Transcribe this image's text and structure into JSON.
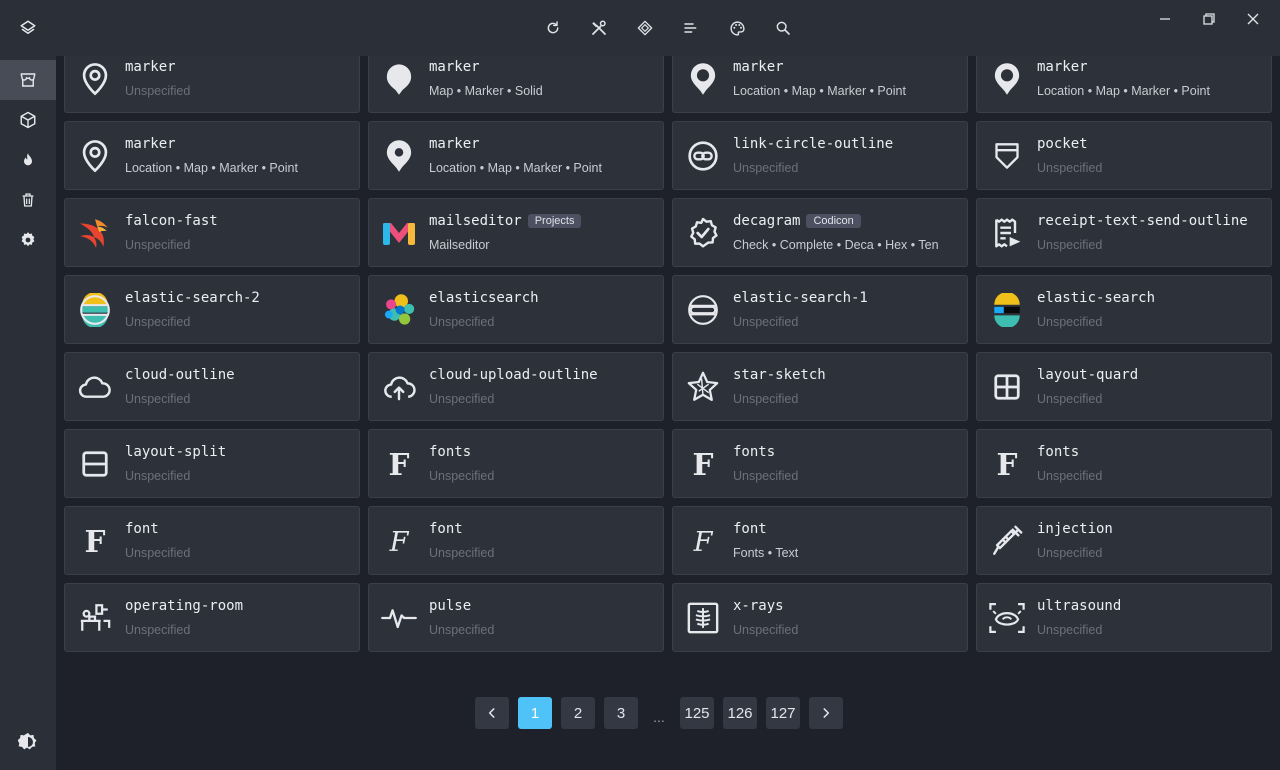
{
  "toolbar": {
    "icons": [
      "refresh-icon",
      "tools-icon",
      "diamond-icon",
      "sort-lines-icon",
      "palette-icon",
      "search-icon"
    ]
  },
  "sidebar": {
    "items": [
      "store-icon",
      "cube-icon",
      "fire-icon",
      "trash-icon",
      "gear-icon"
    ],
    "active_index": 0,
    "bottom": "theme-toggle-icon"
  },
  "icons": [
    {
      "name": "marker",
      "tags": "Unspecified",
      "muted": true,
      "icon": "map-marker-outline"
    },
    {
      "name": "marker",
      "tags": "Map • Marker • Solid",
      "muted": false,
      "icon": "map-marker-solid"
    },
    {
      "name": "marker",
      "tags": "Location • Map • Marker • Point",
      "muted": false,
      "icon": "map-marker-ring"
    },
    {
      "name": "marker",
      "tags": "Location • Map • Marker • Point",
      "muted": false,
      "icon": "map-marker-ring"
    },
    {
      "name": "marker",
      "tags": "Location • Map • Marker • Point",
      "muted": false,
      "icon": "map-marker-outline"
    },
    {
      "name": "marker",
      "tags": "Location • Map • Marker • Point",
      "muted": false,
      "icon": "map-marker-dot"
    },
    {
      "name": "link-circle-outline",
      "tags": "Unspecified",
      "muted": true,
      "icon": "link-circle"
    },
    {
      "name": "pocket",
      "tags": "Unspecified",
      "muted": true,
      "icon": "pocket"
    },
    {
      "name": "falcon-fast",
      "tags": "Unspecified",
      "muted": true,
      "icon": "falcon"
    },
    {
      "name": "mailseditor",
      "badge": "Projects",
      "tags": "Mailseditor",
      "muted": false,
      "icon": "mailseditor"
    },
    {
      "name": "decagram",
      "badge": "Codicon",
      "tags": "Check • Complete • Deca • Hex • Ten",
      "muted": false,
      "icon": "decagram"
    },
    {
      "name": "receipt-text-send-outline",
      "tags": "Unspecified",
      "muted": true,
      "icon": "receipt"
    },
    {
      "name": "elastic-search-2",
      "tags": "Unspecified",
      "muted": true,
      "icon": "elastic-color"
    },
    {
      "name": "elasticsearch",
      "tags": "Unspecified",
      "muted": true,
      "icon": "elastic-dots"
    },
    {
      "name": "elastic-search-1",
      "tags": "Unspecified",
      "muted": true,
      "icon": "elastic-outline"
    },
    {
      "name": "elastic-search",
      "tags": "Unspecified",
      "muted": true,
      "icon": "elastic-color2"
    },
    {
      "name": "cloud-outline",
      "tags": "Unspecified",
      "muted": true,
      "icon": "cloud"
    },
    {
      "name": "cloud-upload-outline",
      "tags": "Unspecified",
      "muted": true,
      "icon": "cloud-upload"
    },
    {
      "name": "star-sketch",
      "tags": "Unspecified",
      "muted": true,
      "icon": "star"
    },
    {
      "name": "layout-quard",
      "tags": "Unspecified",
      "muted": true,
      "icon": "layout-quad"
    },
    {
      "name": "layout-split",
      "tags": "Unspecified",
      "muted": true,
      "icon": "layout-split"
    },
    {
      "name": "fonts",
      "tags": "Unspecified",
      "muted": true,
      "icon": "font-f"
    },
    {
      "name": "fonts",
      "tags": "Unspecified",
      "muted": true,
      "icon": "font-f"
    },
    {
      "name": "fonts",
      "tags": "Unspecified",
      "muted": true,
      "icon": "font-f"
    },
    {
      "name": "font",
      "tags": "Unspecified",
      "muted": true,
      "icon": "font-f"
    },
    {
      "name": "font",
      "tags": "Unspecified",
      "muted": true,
      "icon": "font-script"
    },
    {
      "name": "font",
      "tags": "Fonts • Text",
      "muted": false,
      "icon": "font-script"
    },
    {
      "name": "injection",
      "tags": "Unspecified",
      "muted": true,
      "icon": "syringe"
    },
    {
      "name": "operating-room",
      "tags": "Unspecified",
      "muted": true,
      "icon": "operating-room"
    },
    {
      "name": "pulse",
      "tags": "Unspecified",
      "muted": true,
      "icon": "pulse"
    },
    {
      "name": "x-rays",
      "tags": "Unspecified",
      "muted": true,
      "icon": "x-rays"
    },
    {
      "name": "ultrasound",
      "tags": "Unspecified",
      "muted": true,
      "icon": "ultrasound"
    }
  ],
  "pagination": {
    "pages": [
      "1",
      "2",
      "3",
      "...",
      "125",
      "126",
      "127"
    ],
    "current": "1"
  },
  "colors": {
    "accent": "#4fc3f7",
    "card_bg": "#2d313a",
    "bg": "#1e2129"
  }
}
